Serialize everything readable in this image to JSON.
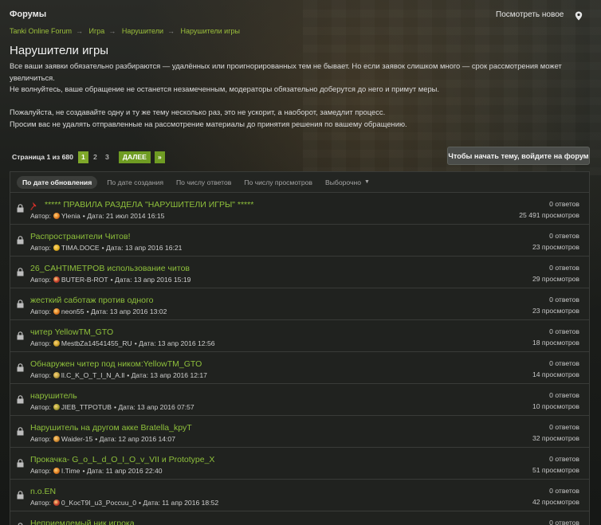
{
  "header": {
    "brand": "Форумы",
    "whats_new": "Посмотреть новое"
  },
  "breadcrumbs": [
    "Tanki Online Forum",
    "Игра",
    "Нарушители",
    "Нарушители игры"
  ],
  "page": {
    "title": "Нарушители игры",
    "desc1": "Все ваши заявки обязательно разбираются — удалённых или проигнорированных тем не бывает. Но если заявок слишком много — срок рассмотрения может увеличиться.",
    "desc2": "Не волнуйтесь, ваше обращение не останется незамеченным, модераторы обязательно доберутся до него и примут меры.",
    "desc3": "Пожалуйста, не создавайте одну и ту же тему несколько раз, это не ускорит, а наоборот, замедлит процесс.",
    "desc4": "Просим вас не удалять отправленные на рассмотрение материалы до принятия решения по вашему обращению."
  },
  "pagination": {
    "label": "Страница 1 из 680",
    "pages": [
      "1",
      "2",
      "3"
    ],
    "next": "ДАЛЕЕ",
    "last": "»"
  },
  "login_button": "Чтобы начать тему, войдите на форум",
  "filters": [
    "По дате обновления",
    "По дате создания",
    "По числу ответов",
    "По числу просмотров",
    "Выборочно"
  ],
  "topics": [
    {
      "title": "***** ПРАВИЛА РАЗДЕЛА \"НАРУШИТЕЛИ ИГРЫ\" *****",
      "author_prefix": "Автор:",
      "author": "Ylenia",
      "date": "• Дата: 21 июл 2014 16:15",
      "replies": "0 ответов",
      "views": "25 491 просмотров",
      "pinned": true,
      "icon_color": "#e07a1e"
    },
    {
      "title": "Распространители Читов!",
      "author_prefix": "Автор:",
      "author": "TIMA.DOCE",
      "date": "• Дата: 13 апр 2016 16:21",
      "replies": "0 ответов",
      "views": "23 просмотров",
      "icon_color": "#e0b21e"
    },
    {
      "title": "26_CAHTIMETPOB использование читов",
      "author_prefix": "Автор:",
      "author": "BUTER-B-ROT",
      "date": "• Дата: 13 апр 2016 15:19",
      "replies": "0 ответов",
      "views": "29 просмотров",
      "icon_color": "#c0392b"
    },
    {
      "title": "жесткий саботаж против одного",
      "author_prefix": "Автор:",
      "author": "neon55",
      "date": "• Дата: 13 апр 2016 13:02",
      "replies": "0 ответов",
      "views": "23 просмотров",
      "icon_color": "#e07a1e"
    },
    {
      "title": "читер YellowTM_GTO",
      "author_prefix": "Автор:",
      "author": "MestbZa14541455_RU",
      "date": "• Дата: 13 апр 2016 12:56",
      "replies": "0 ответов",
      "views": "18 просмотров",
      "icon_color": "#c9a227"
    },
    {
      "title": "Обнаружен читер под ником:YellowTM_GTO",
      "author_prefix": "Автор:",
      "author": "ll.C_K_O_T_I_N_A.ll",
      "date": "• Дата: 13 апр 2016 12:17",
      "replies": "0 ответов",
      "views": "14 просмотров",
      "icon_color": "#b8a040"
    },
    {
      "title": "нарушитель",
      "author_prefix": "Автор:",
      "author": "JIEB_TTPOTUB",
      "date": "• Дата: 13 апр 2016 07:57",
      "replies": "0 ответов",
      "views": "10 просмотров",
      "icon_color": "#a0a030"
    },
    {
      "title": "Нарушитель на другом акке Bratella_kpyT",
      "author_prefix": "Автор:",
      "author": "Waider-15",
      "date": "• Дата: 12 апр 2016 14:07",
      "replies": "0 ответов",
      "views": "32 просмотров",
      "icon_color": "#d08a30"
    },
    {
      "title": "Прокачка- G_o_L_d_O_I_O_v_VII и Prototype_X",
      "author_prefix": "Автор:",
      "author": "I.Time",
      "date": "• Дата: 11 апр 2016 22:40",
      "replies": "0 ответов",
      "views": "51 просмотров",
      "icon_color": "#e07a1e"
    },
    {
      "title": "n.o.EN",
      "author_prefix": "Автор:",
      "author": "0_KocT9I_u3_Poccuu_0",
      "date": "• Дата: 11 апр 2016 18:52",
      "replies": "0 ответов",
      "views": "42 просмотров",
      "icon_color": "#c0392b"
    },
    {
      "title": "Неприемлемый ник игрока",
      "author_prefix": "",
      "author": "",
      "date": "",
      "replies": "0 ответов",
      "views": "",
      "icon_color": "#c0392b"
    }
  ],
  "icons": {
    "lock": "lock-icon",
    "pin": "pin-icon",
    "location": "location-pin-icon"
  }
}
